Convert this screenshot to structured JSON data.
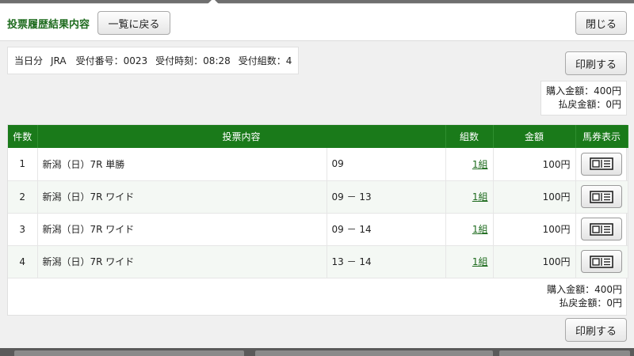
{
  "header": {
    "title": "投票履歴結果内容",
    "back_label": "一覧に戻る",
    "close_label": "閉じる"
  },
  "info": {
    "day": "当日分",
    "org": "JRA",
    "receipt_no": "受付番号：0023",
    "receipt_time": "受付時刻：08:28",
    "receipt_count": "受付組数：4"
  },
  "actions": {
    "print_label": "印刷する"
  },
  "summary": {
    "purchase": "購入金額：400円",
    "refund": "払戻金額：0円"
  },
  "table": {
    "headers": [
      "件数",
      "投票内容",
      "組数",
      "金額",
      "馬券表示"
    ],
    "rows": [
      {
        "no": "1",
        "race": "新潟（日）7R 単勝",
        "combo": "09",
        "kumi": "1組",
        "amount": "100円"
      },
      {
        "no": "2",
        "race": "新潟（日）7R ワイド",
        "combo": "09 － 13",
        "kumi": "1組",
        "amount": "100円"
      },
      {
        "no": "3",
        "race": "新潟（日）7R ワイド",
        "combo": "09 － 14",
        "kumi": "1組",
        "amount": "100円"
      },
      {
        "no": "4",
        "race": "新潟（日）7R ワイド",
        "combo": "13 － 14",
        "kumi": "1組",
        "amount": "100円"
      }
    ]
  },
  "icons": {
    "ticket": "ticket-icon"
  },
  "colors": {
    "accent_green": "#1a7a1a",
    "title_green": "#1e6b1e"
  }
}
